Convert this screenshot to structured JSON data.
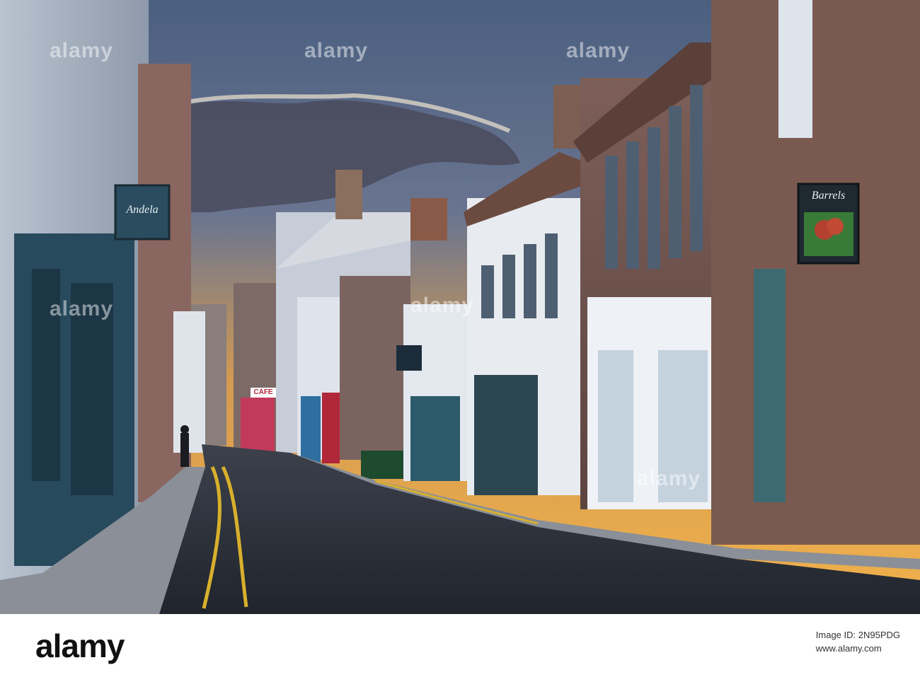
{
  "photo": {
    "description_icon": "street-photo",
    "palette": {
      "sky_top": "#4e6282",
      "sky_glow": "#e6a040",
      "road": "#2b2f38",
      "line_yellow": "#d8b02c"
    }
  },
  "signs": {
    "left_hanging_sign": "Andela",
    "cafe_sign": "CAFE",
    "right_hanging_sign": "Barrels"
  },
  "watermark": {
    "text": "alamy"
  },
  "footer": {
    "logo": "alamy",
    "image_id_label": "Image ID: 2N95PDG",
    "image_id": "",
    "website": "www.alamy.com"
  }
}
